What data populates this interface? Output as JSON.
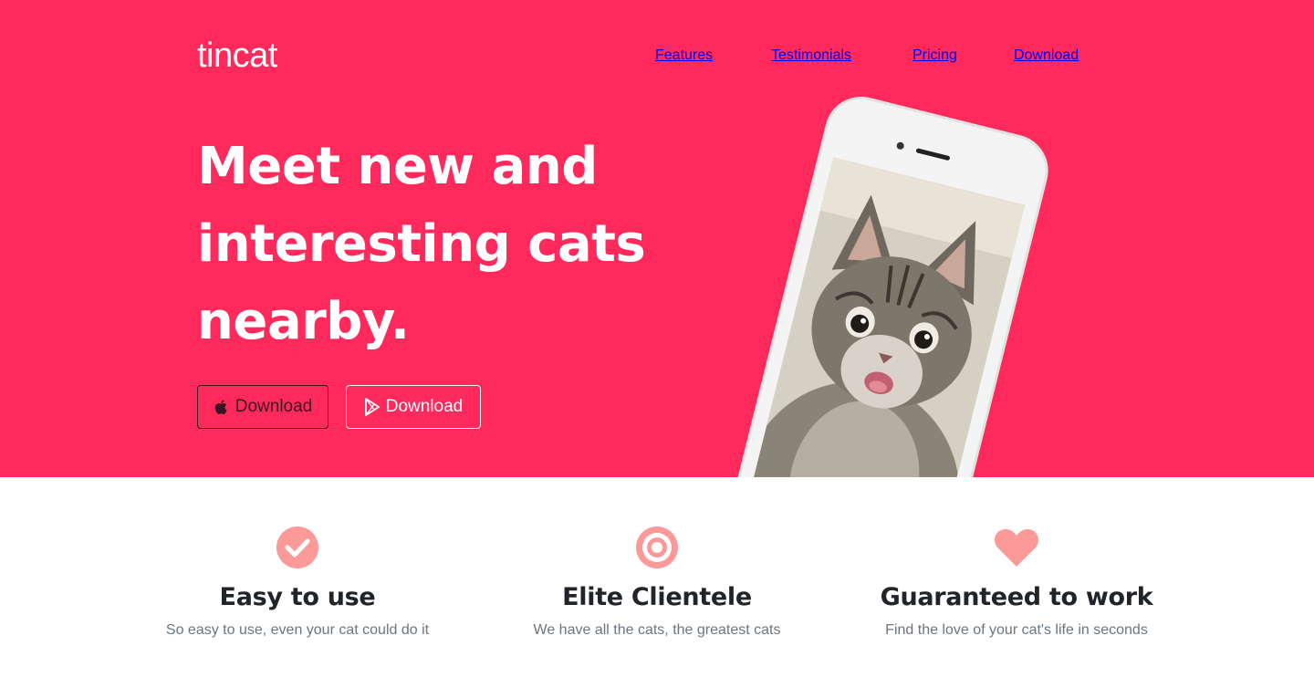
{
  "brand": "tincat",
  "nav": {
    "items": [
      "Features",
      "Testimonials",
      "Pricing",
      "Download"
    ]
  },
  "hero": {
    "headline_line1": "Meet new and",
    "headline_line2": "interesting cats",
    "headline_line3": "nearby.",
    "buttons": {
      "apple": {
        "label": "Download",
        "icon": "apple-icon"
      },
      "play": {
        "label": "Download",
        "icon": "play-store-icon"
      }
    },
    "phone_image": "kitten-photo"
  },
  "features": [
    {
      "icon": "check-circle-icon",
      "title": "Easy to use",
      "desc": "So easy to use, even your cat could do it"
    },
    {
      "icon": "target-icon",
      "title": "Elite Clientele",
      "desc": "We have all the cats, the greatest cats"
    },
    {
      "icon": "heart-icon",
      "title": "Guaranteed to work",
      "desc": "Find the love of your cat's life in seconds"
    }
  ],
  "colors": {
    "hero_bg": "#ff2a5b",
    "feature_icon": "#fb9a99",
    "heading": "#212529",
    "muted": "#6c757d"
  }
}
